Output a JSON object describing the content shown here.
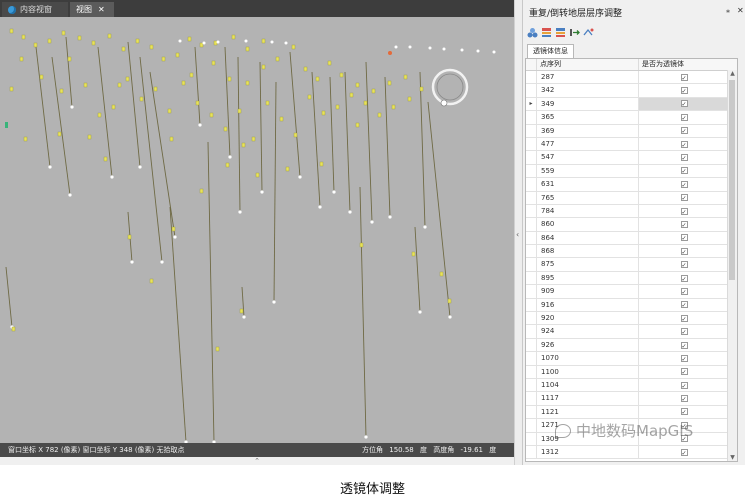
{
  "tabs": [
    {
      "label": "内容视窗",
      "icon": "globe-icon",
      "active": false
    },
    {
      "label": "视图",
      "icon": "close-icon",
      "active": true
    }
  ],
  "viewport": {
    "background_color": "#b3b3b3",
    "status": {
      "left": "窗口坐标 X 782 (像素) 窗口坐标 Y 348 (像素) 无拾取点",
      "azimuth_label": "方位角",
      "azimuth_value": "150.58",
      "azimuth_unit": "度",
      "altitude_label": "高度角",
      "altitude_value": "-19.61",
      "altitude_unit": "度"
    }
  },
  "panel": {
    "title": "重复/倒转地层层序调整",
    "pin_icon": "pin-icon",
    "close_icon": "close-icon",
    "tools": [
      "layers-icon",
      "reorder-icon",
      "flip-icon",
      "move-icon",
      "shuffle-icon"
    ],
    "subtab": "透镜体信息",
    "columns": [
      "点序列",
      "是否为透镜体"
    ],
    "rows": [
      {
        "id": "287",
        "checked": true,
        "selected": false
      },
      {
        "id": "342",
        "checked": true,
        "selected": false
      },
      {
        "id": "349",
        "checked": true,
        "selected": true
      },
      {
        "id": "365",
        "checked": true,
        "selected": false
      },
      {
        "id": "369",
        "checked": true,
        "selected": false
      },
      {
        "id": "477",
        "checked": true,
        "selected": false
      },
      {
        "id": "547",
        "checked": true,
        "selected": false
      },
      {
        "id": "559",
        "checked": true,
        "selected": false
      },
      {
        "id": "631",
        "checked": true,
        "selected": false
      },
      {
        "id": "765",
        "checked": true,
        "selected": false
      },
      {
        "id": "784",
        "checked": true,
        "selected": false
      },
      {
        "id": "860",
        "checked": true,
        "selected": false
      },
      {
        "id": "864",
        "checked": true,
        "selected": false
      },
      {
        "id": "868",
        "checked": true,
        "selected": false
      },
      {
        "id": "875",
        "checked": true,
        "selected": false
      },
      {
        "id": "895",
        "checked": true,
        "selected": false
      },
      {
        "id": "909",
        "checked": true,
        "selected": false
      },
      {
        "id": "916",
        "checked": true,
        "selected": false
      },
      {
        "id": "920",
        "checked": true,
        "selected": false
      },
      {
        "id": "924",
        "checked": true,
        "selected": false
      },
      {
        "id": "926",
        "checked": true,
        "selected": false
      },
      {
        "id": "1070",
        "checked": true,
        "selected": false
      },
      {
        "id": "1100",
        "checked": true,
        "selected": false
      },
      {
        "id": "1104",
        "checked": true,
        "selected": false
      },
      {
        "id": "1117",
        "checked": true,
        "selected": false
      },
      {
        "id": "1121",
        "checked": true,
        "selected": false
      },
      {
        "id": "1271",
        "checked": true,
        "selected": false
      },
      {
        "id": "1309",
        "checked": true,
        "selected": false
      },
      {
        "id": "1312",
        "checked": true,
        "selected": false
      }
    ]
  },
  "watermark": "中地数码MapGIS",
  "caption": "透镜体调整"
}
